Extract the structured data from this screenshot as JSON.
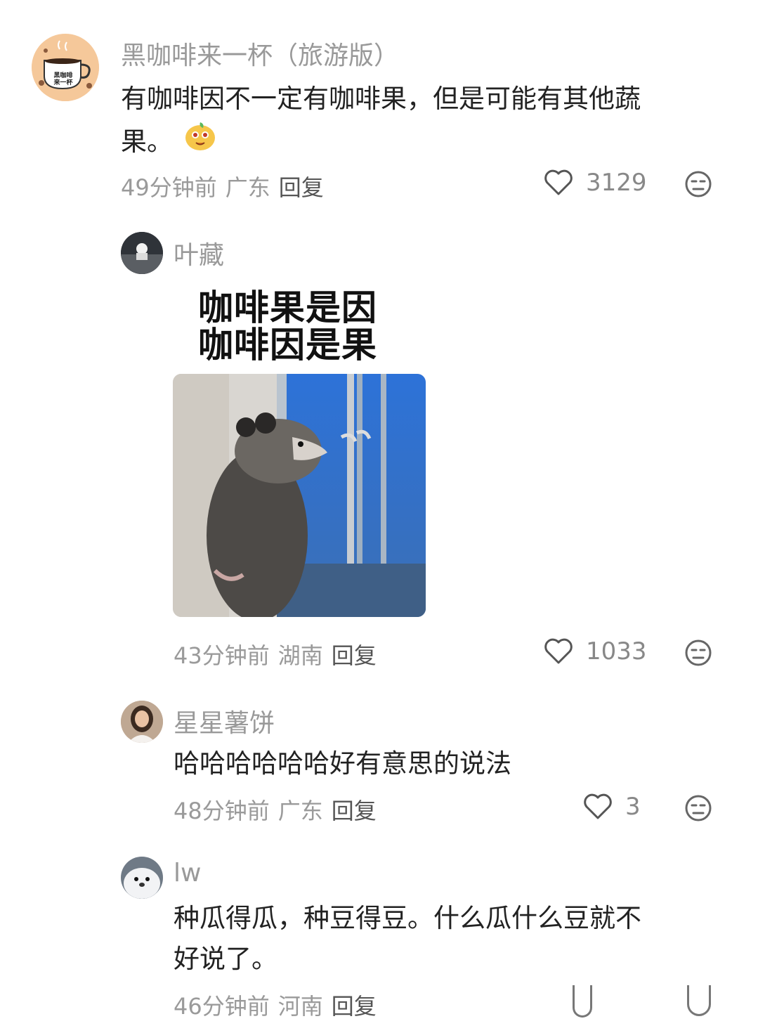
{
  "comments": [
    {
      "name": "黑咖啡来一杯（旅游版）",
      "avatar_text": [
        "黑咖啡",
        "来一杯"
      ],
      "text_line1": "有咖啡因不一定有咖啡果，但是可能有其他蔬",
      "text_line2": "果。",
      "time": "49分钟前",
      "location": "广东",
      "reply": "回复",
      "likes": "3129"
    },
    {
      "name": "叶藏",
      "meme_line1": "咖啡果是因",
      "meme_line2": "咖啡因是果",
      "time": "43分钟前",
      "location": "湖南",
      "reply": "回复",
      "likes": "1033"
    },
    {
      "name": "星星薯饼",
      "text_line1": "哈哈哈哈哈哈好有意思的说法",
      "time": "48分钟前",
      "location": "广东",
      "reply": "回复",
      "likes": "3"
    },
    {
      "name": "lw",
      "text_line1": "种瓜得瓜，种豆得豆。什么瓜什么豆就不",
      "text_line2": "好说了。",
      "time": "46分钟前",
      "location": "河南",
      "reply": "回复"
    }
  ],
  "colors": {
    "meta_gray": "#9a9a9a",
    "name_gray": "#999999",
    "sky_blue": "#3e7fd6"
  },
  "icons": [
    "heart-icon",
    "dislike-face-icon",
    "coffee-cup-icon",
    "emoji-sticker-icon"
  ]
}
